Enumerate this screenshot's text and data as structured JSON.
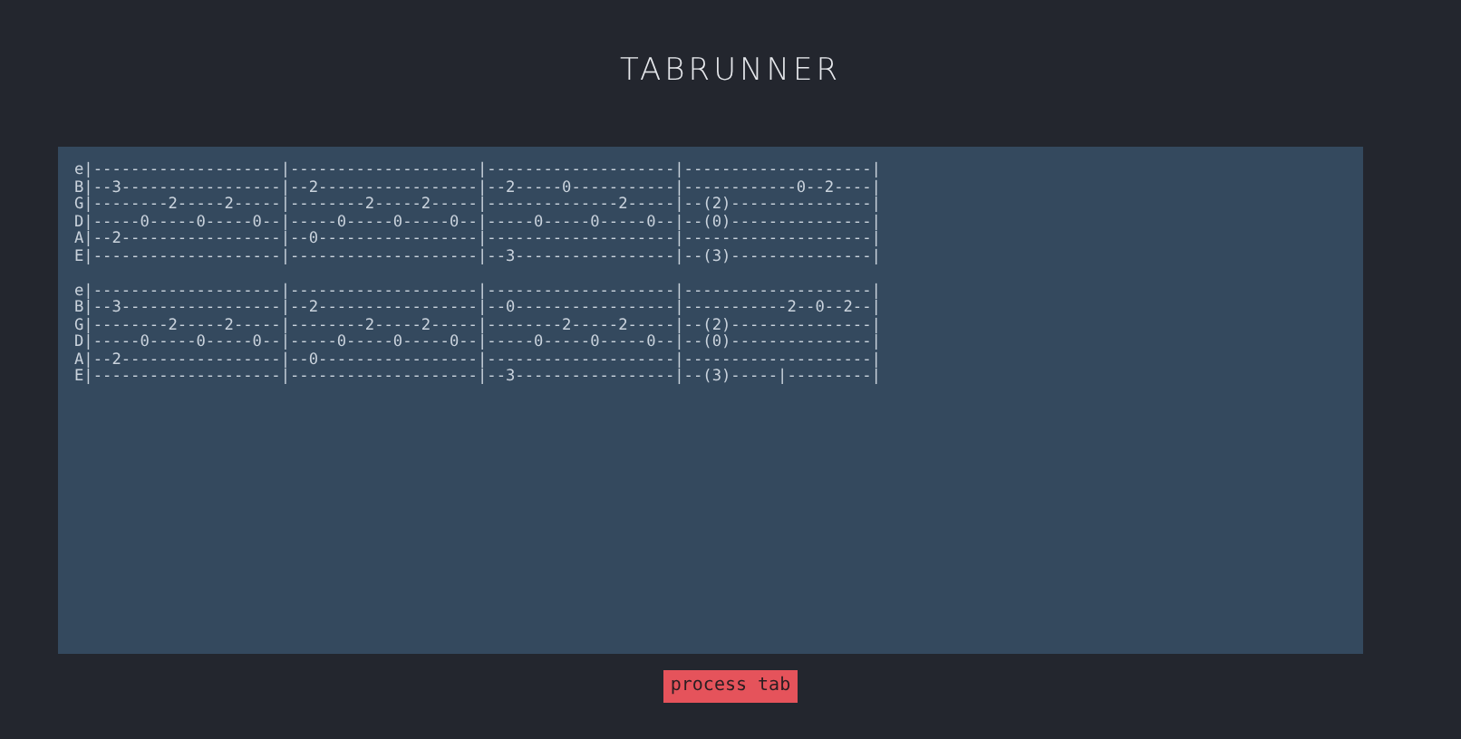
{
  "logo": "TABRUNNER",
  "tab_blocks": [
    {
      "lines": [
        "e|--------------------|--------------------|--------------------|--------------------|",
        "B|--3-----------------|--2-----------------|--2-----0-----------|------------0--2----|",
        "G|--------2-----2-----|--------2-----2-----|--------------2-----|--(2)---------------|",
        "D|-----0-----0-----0--|-----0-----0-----0--|-----0-----0-----0--|--(0)---------------|",
        "A|--2-----------------|--0-----------------|--------------------|--------------------|",
        "E|--------------------|--------------------|--3-----------------|--(3)---------------|"
      ]
    },
    {
      "lines": [
        "e|--------------------|--------------------|--------------------|--------------------|",
        "B|--3-----------------|--2-----------------|--0-----------------|-----------2--0--2--|",
        "G|--------2-----2-----|--------2-----2-----|--------2-----2-----|--(2)---------------|",
        "D|-----0-----0-----0--|-----0-----0-----0--|-----0-----0-----0--|--(0)---------------|",
        "A|--2-----------------|--0-----------------|--------------------|--------------------|",
        "E|--------------------|--------------------|--3-----------------|--(3)-----|---------|"
      ]
    }
  ],
  "button": "process tab"
}
